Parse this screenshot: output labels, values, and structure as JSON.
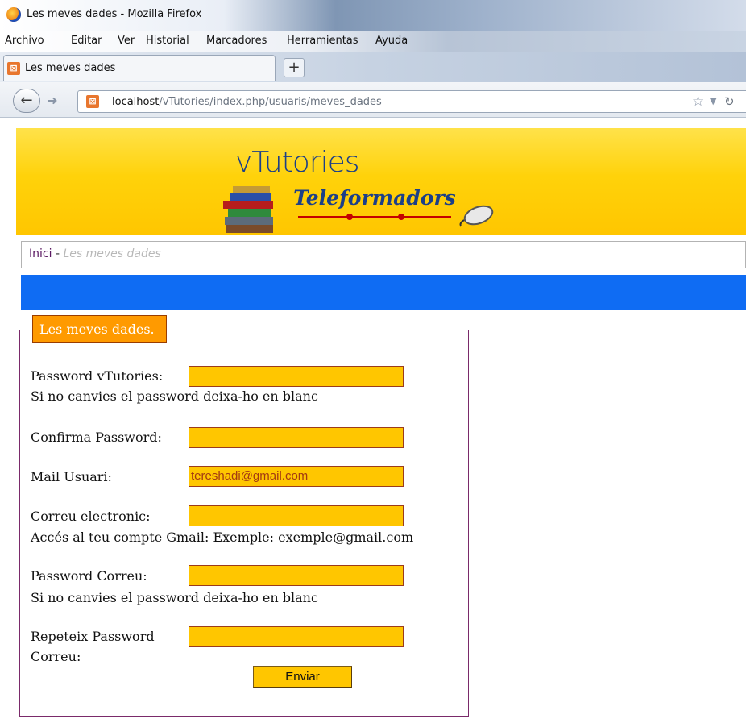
{
  "window": {
    "title": "Les meves dades - Mozilla Firefox"
  },
  "menu": [
    "Archivo",
    "Editar",
    "Ver",
    "Historial",
    "Marcadores",
    "Herramientas",
    "Ayuda"
  ],
  "tab": {
    "label": "Les meves dades"
  },
  "url": {
    "host": "localhost",
    "path": "/vTutories/index.php/usuaris/meves_dades"
  },
  "banner": {
    "brand": "vTutories",
    "subtitle": "Teleformadors"
  },
  "breadcrumb": {
    "home": "Inici",
    "separator": "-",
    "current": "Les meves dades"
  },
  "form": {
    "legend": "Les meves dades.",
    "fields": [
      {
        "label": "Password vTutories:",
        "value": "",
        "hint": "Si no canvies el password deixa-ho en blanc"
      },
      {
        "label": "Confirma Password:",
        "value": ""
      },
      {
        "label": "Mail Usuari:",
        "value": "tereshadi@gmail.com"
      },
      {
        "label": "Correu electronic:",
        "value": "",
        "hint": "Accés al teu compte Gmail: Exemple: exemple@gmail.com"
      },
      {
        "label": "Password Correu:",
        "value": "",
        "hint": "Si no canvies el password deixa-ho en blanc"
      },
      {
        "label_line1": "Repeteix Password",
        "label_line2": "Correu:",
        "value": ""
      }
    ],
    "submit_label": "Enviar"
  },
  "colors": {
    "banner": "#ffd20a",
    "bluebar": "#0f6cf3",
    "legend": "#ff9a00",
    "field": "#ffc600",
    "field_border": "#9b3b1c",
    "fieldset_border": "#7a2a6a"
  }
}
